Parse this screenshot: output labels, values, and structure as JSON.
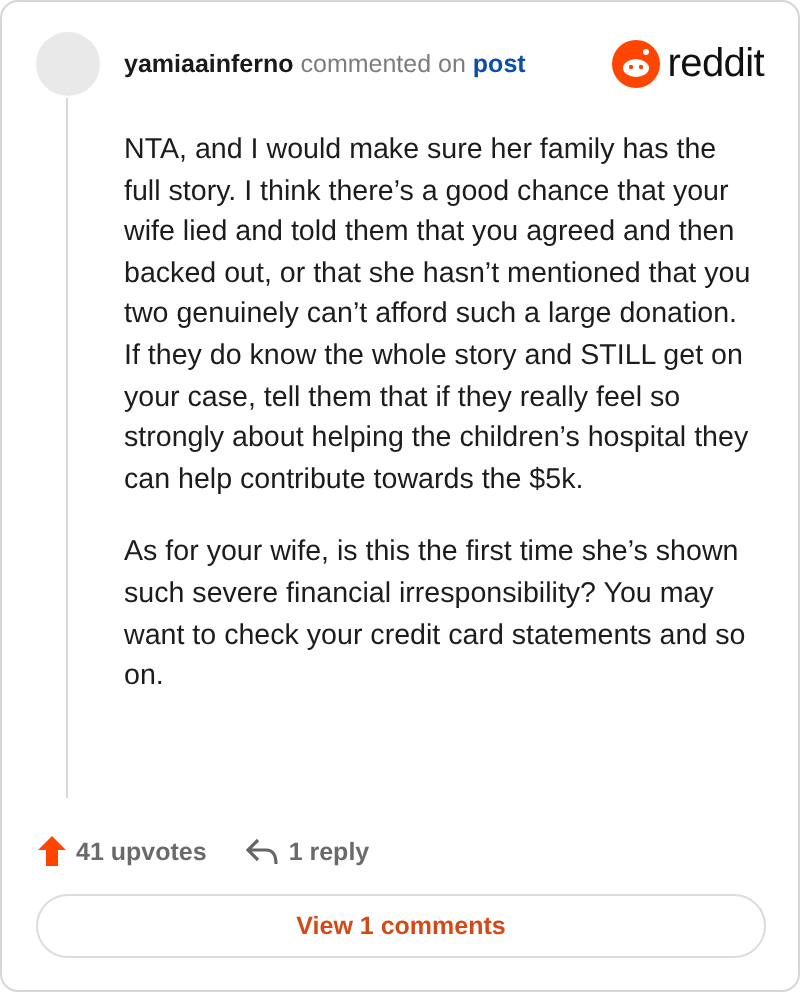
{
  "header": {
    "username": "yamiaainferno",
    "action": "commented on",
    "link": "post",
    "brand": "reddit"
  },
  "paragraphs": [
    "NTA, and I would make sure her family has the full story. I think there’s a good chance that your wife lied and told them that you agreed and then backed out, or that she hasn’t mentioned that you two genuinely can’t afford such a large donation. If they do know the whole story and STILL get on your case, tell them that if they really feel so strongly about helping the children’s hospital they can help contribute towards the $5k.",
    "As for your wife, is this the first time she’s shown such severe financial irresponsibility? You may want to check your credit card statements and so on."
  ],
  "footer": {
    "upvotes": "41 upvotes",
    "replies": "1 reply"
  },
  "view_button": "View 1 comments"
}
